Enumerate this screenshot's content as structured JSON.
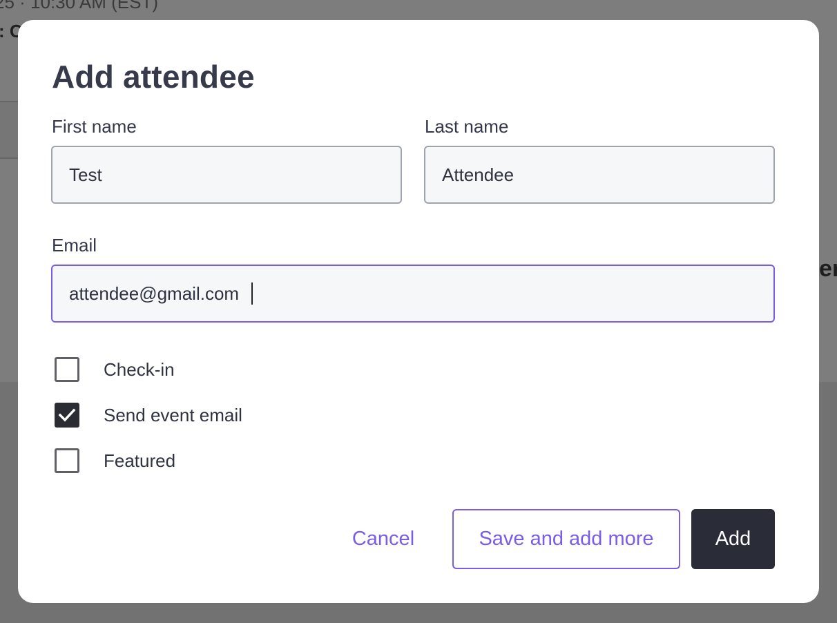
{
  "background": {
    "partial_text_top": "25 · 10:30 AM (EST)",
    "partial_text_left": ": C",
    "partial_text_right": "er"
  },
  "dialog": {
    "title": "Add attendee",
    "first_name": {
      "label": "First name",
      "value": "Test"
    },
    "last_name": {
      "label": "Last name",
      "value": "Attendee"
    },
    "email": {
      "label": "Email",
      "value": "attendee@gmail.com"
    },
    "options": [
      {
        "label": "Check-in",
        "checked": false
      },
      {
        "label": "Send event email",
        "checked": true
      },
      {
        "label": "Featured",
        "checked": false
      }
    ],
    "buttons": {
      "cancel": "Cancel",
      "save_and_add_more": "Save and add more",
      "add": "Add"
    }
  },
  "colors": {
    "accent": "#7b5ce6",
    "primary_button": "#2a2c38",
    "overlay": "#808080"
  },
  "icons": {
    "checkmark": "check-icon"
  }
}
